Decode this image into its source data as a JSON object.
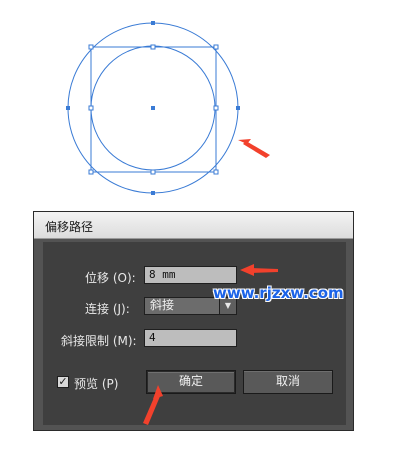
{
  "dialog": {
    "title": "偏移路径",
    "offset_label": "位移 (O):",
    "offset_value": "8 mm",
    "joins_label": "连接 (J):",
    "joins_value": "斜接",
    "miter_label": "斜接限制 (M):",
    "miter_value": "4",
    "preview_label": "预览 (P)",
    "preview_checked": true,
    "ok_label": "确定",
    "cancel_label": "取消"
  },
  "watermark": "www.rjzxw.com",
  "colors": {
    "selection_blue": "#3a7bd5",
    "annotation_red": "#f2412c",
    "dialog_bg": "#535353",
    "panel_bg": "#3f3f3f"
  }
}
